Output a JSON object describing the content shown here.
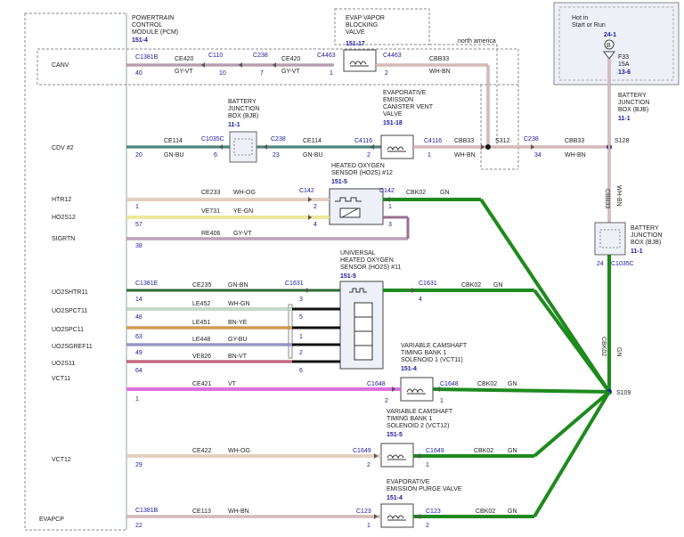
{
  "pcm": {
    "title": [
      "POWERTRAIN",
      "CONTROL",
      "MODULE (PCM)"
    ],
    "ref": "151-4",
    "signals": [
      "CANV",
      "CDV #2",
      "HTR12",
      "HO2S12",
      "SIGRTN",
      "UO2SHTR11",
      "UO2SPCT11",
      "UO2SPC11",
      "UO2SGREF11",
      "UO2S11",
      "VCT11",
      "VCT12",
      "EVAPCP"
    ]
  },
  "hot_box": {
    "lines": [
      "Hot in",
      "Start or Run"
    ],
    "ref": "24-1",
    "fuse_letter": "B",
    "fuse": "F33",
    "amps": "15A",
    "fuse_ref": "13-6"
  },
  "components": {
    "evap_vapor": {
      "lines": [
        "EVAP VAPOR",
        "BLOCKING",
        "VALVE"
      ],
      "ref": "151-17"
    },
    "bjb_left": {
      "lines": [
        "BATTERY",
        "JUNCTION",
        "BOX (BJB)"
      ],
      "ref": "11-1"
    },
    "canister": {
      "lines": [
        "EVAPORATIVE",
        "EMISSION",
        "CANISTER VENT",
        "VALVE"
      ],
      "ref": "151-18"
    },
    "bjb_right_top": {
      "lines": [
        "BATTERY",
        "JUNCTION",
        "BOX (BJB)"
      ],
      "ref": "11-1"
    },
    "ho2s12": {
      "lines": [
        "HEATED OXYGEN",
        "SENSOR (HO2S) #12"
      ],
      "ref": "151-5"
    },
    "bjb_right_mid": {
      "lines": [
        "BATTERY",
        "JUNCTION",
        "BOX (BJB)"
      ],
      "ref": "11-1"
    },
    "uho2s11": {
      "lines": [
        "UNIVERSAL",
        "HEATED OXYGEN",
        "SENSOR (HO2S) #11"
      ],
      "ref": "151-5"
    },
    "vct11": {
      "lines": [
        "VARIABLE CAMSHAFT",
        "TIMING BANK 1",
        "SOLENOID 1 (VCT11)"
      ],
      "ref": "151-4"
    },
    "vct12": {
      "lines": [
        "VARIABLE CAMSHAFT",
        "TIMING BANK 1",
        "SOLENOID 2 (VCT12)"
      ],
      "ref": "151-5"
    },
    "purge": {
      "lines": [
        "EVAPORATIVE",
        "EMISSION PURGE VALVE"
      ],
      "ref": "151-4"
    }
  },
  "labels": {
    "north_america": "north america",
    "c1381b": "C1381B",
    "c1381e": "C1381E",
    "c110": "C110",
    "c238": "C238",
    "c4463": "C4463",
    "c1035c": "C1035C",
    "c4116": "C4116",
    "c142": "C142",
    "c1631": "C1631",
    "c1648": "C1648",
    "c1649": "C1649",
    "c123": "C123",
    "s312": "S312",
    "s128": "S128",
    "s109": "S109",
    "ce420": "CE420",
    "ce114": "CE114",
    "cbb33": "CBB33",
    "ce233": "CE233",
    "ve731": "VE731",
    "re406": "RE406",
    "ce235": "CE235",
    "le452": "LE452",
    "le451": "LE451",
    "le448": "LE448",
    "ve826": "VE826",
    "ce421": "CE421",
    "ce422": "CE422",
    "ce113": "CE113",
    "cbk02": "CBK02",
    "gyvt": "GY-VT",
    "whbn": "WH-BN",
    "gnbu": "GN-BU",
    "whog": "WH-OG",
    "yegn": "YE-GN",
    "gn": "GN",
    "gnbn": "GN-BN",
    "whgn": "WH-GN",
    "bnye": "BN-YE",
    "gybu": "GY-BU",
    "bnvt": "BN-VT",
    "vt": "VT",
    "p40": "40",
    "p10": "10",
    "p7": "7",
    "p1": "1",
    "p2": "2",
    "p20": "20",
    "p6": "6",
    "p23": "23",
    "p34": "34",
    "p3": "3",
    "p4": "4",
    "p57": "57",
    "p38": "38",
    "p14": "14",
    "p48": "48",
    "p5": "5",
    "p63": "63",
    "p49": "49",
    "p64": "64",
    "p29": "29",
    "p22": "22",
    "p24": "24"
  },
  "colors": {
    "gn": "#1e8a1e",
    "vt": "#e070e0",
    "blue": "#1a1a9a"
  }
}
